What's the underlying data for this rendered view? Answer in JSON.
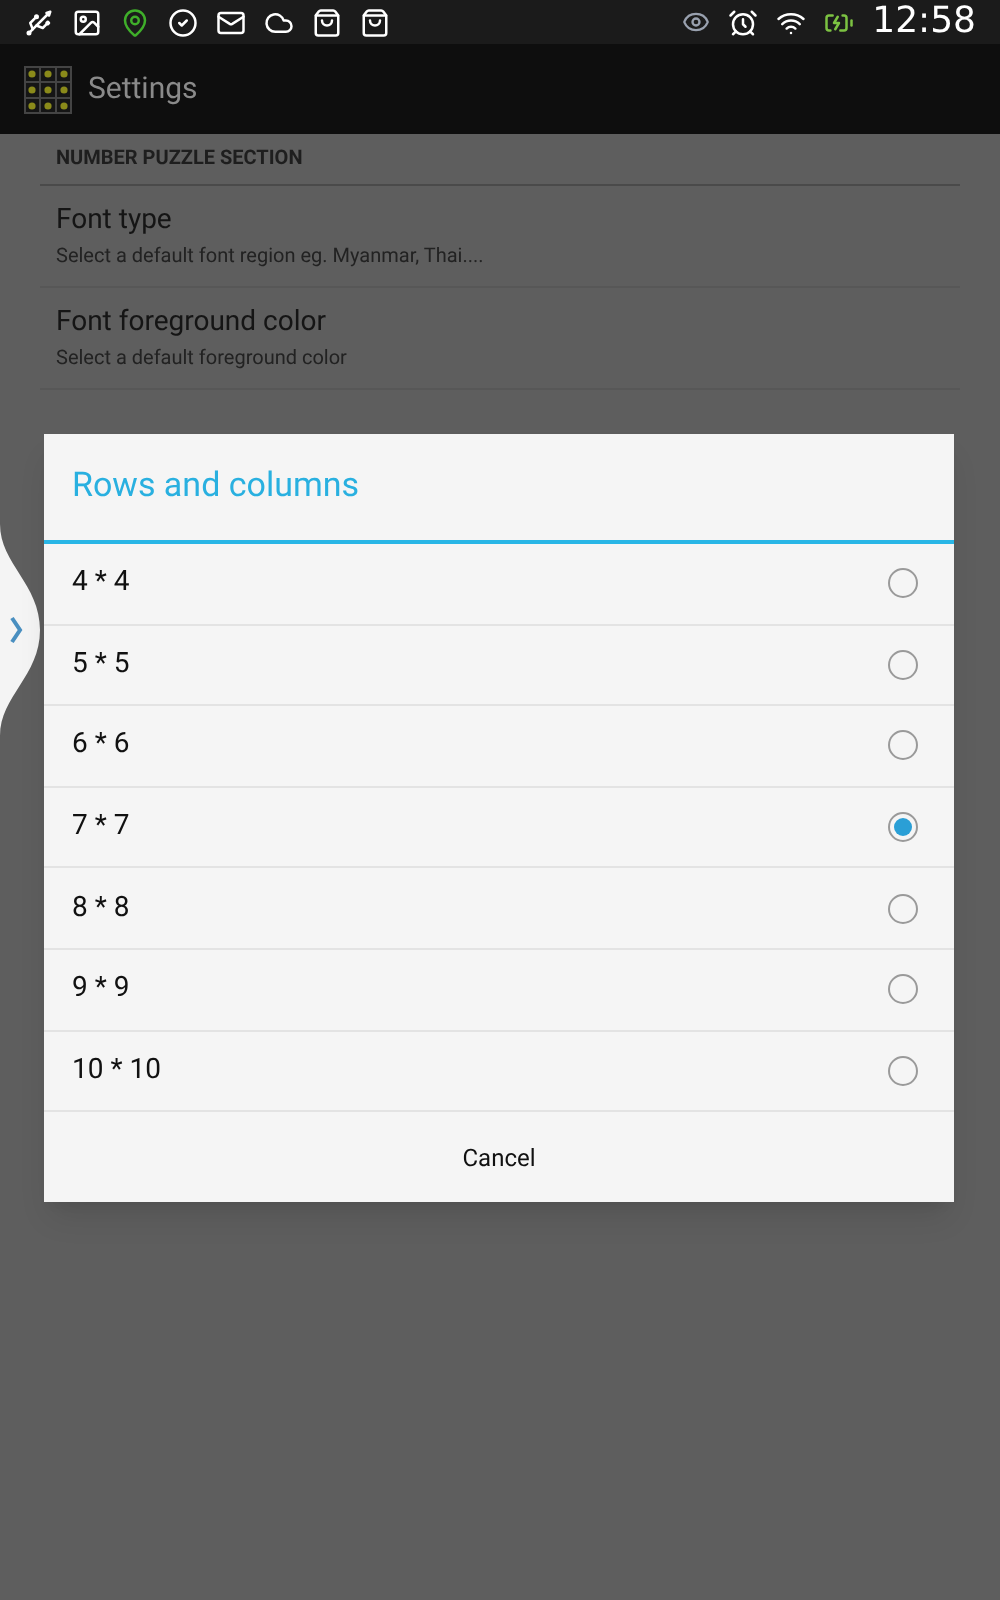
{
  "status_bar": {
    "time": "12:58"
  },
  "app_bar": {
    "title": "Settings"
  },
  "settings": {
    "section": "NUMBER PUZZLE SECTION",
    "items": [
      {
        "title": "Font type",
        "summary": "Select a default font region eg. Myanmar, Thai...."
      },
      {
        "title": "Font foreground color",
        "summary": "Select a default foreground color"
      }
    ]
  },
  "dialog": {
    "title": "Rows and columns",
    "options": [
      {
        "label": "4 * 4",
        "selected": false
      },
      {
        "label": "5 * 5",
        "selected": false
      },
      {
        "label": "6 * 6",
        "selected": false
      },
      {
        "label": "7 * 7",
        "selected": true
      },
      {
        "label": "8 * 8",
        "selected": false
      },
      {
        "label": "9 * 9",
        "selected": false
      },
      {
        "label": "10 * 10",
        "selected": false
      }
    ],
    "button": "Cancel"
  }
}
